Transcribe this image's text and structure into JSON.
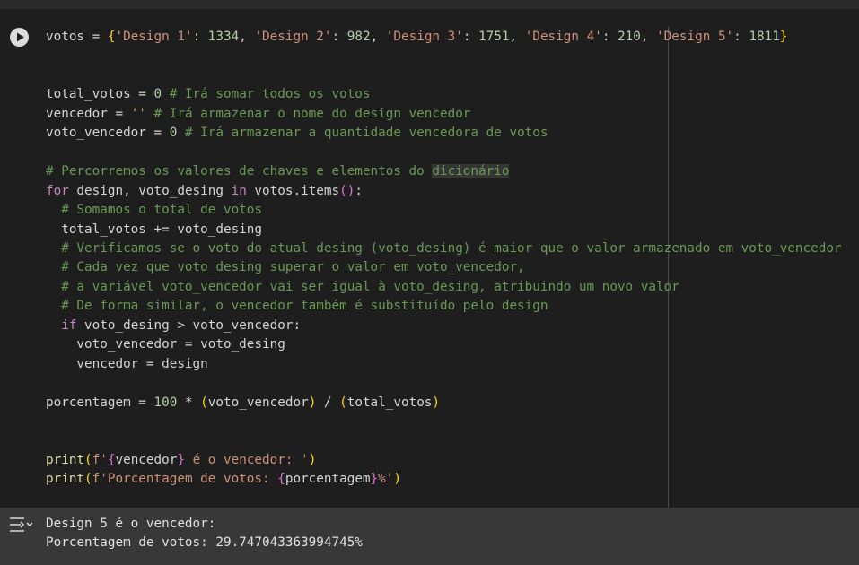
{
  "notebook": {
    "colors": {
      "background": "#1e1e1e",
      "output_background": "#383838",
      "keyword": "#c586c0",
      "string": "#ce9178",
      "number": "#b5cea8",
      "comment": "#6a9955",
      "function": "#dcdcaa"
    },
    "run_icon": "play-circle-icon",
    "output_icon": "output-toggle-icon",
    "code_lines": [
      {
        "row": 0,
        "tokens": [
          {
            "t": "votos = ",
            "c": "n"
          },
          {
            "t": "{",
            "c": "b"
          },
          {
            "t": "'Design 1'",
            "c": "s"
          },
          {
            "t": ": ",
            "c": "n"
          },
          {
            "t": "1334",
            "c": "num"
          },
          {
            "t": ", ",
            "c": "n"
          },
          {
            "t": "'Design 2'",
            "c": "s"
          },
          {
            "t": ": ",
            "c": "n"
          },
          {
            "t": "982",
            "c": "num"
          },
          {
            "t": ", ",
            "c": "n"
          },
          {
            "t": "'Design 3'",
            "c": "s"
          },
          {
            "t": ": ",
            "c": "n"
          },
          {
            "t": "1751",
            "c": "num"
          },
          {
            "t": ", ",
            "c": "n"
          },
          {
            "t": "'Design 4'",
            "c": "s"
          },
          {
            "t": ": ",
            "c": "n"
          },
          {
            "t": "210",
            "c": "num"
          },
          {
            "t": ", ",
            "c": "n"
          },
          {
            "t": "'Design 5'",
            "c": "s"
          },
          {
            "t": ": ",
            "c": "n"
          },
          {
            "t": "1811",
            "c": "num"
          },
          {
            "t": "}",
            "c": "b"
          }
        ]
      },
      {
        "row": 3,
        "tokens": [
          {
            "t": "total_votos = ",
            "c": "n"
          },
          {
            "t": "0",
            "c": "num"
          },
          {
            "t": " # Irá somar todos os votos",
            "c": "c"
          }
        ]
      },
      {
        "row": 4,
        "tokens": [
          {
            "t": "vencedor = ",
            "c": "n"
          },
          {
            "t": "''",
            "c": "s"
          },
          {
            "t": " # Irá armazenar o nome do design vencedor",
            "c": "c"
          }
        ]
      },
      {
        "row": 5,
        "tokens": [
          {
            "t": "voto_vencedor = ",
            "c": "n"
          },
          {
            "t": "0",
            "c": "num"
          },
          {
            "t": " # Irá armazenar a quantidade vencedora de votos",
            "c": "c"
          }
        ]
      },
      {
        "row": 7,
        "tokens": [
          {
            "t": "# Percorremos os valores de chaves e elementos do ",
            "c": "c"
          },
          {
            "t": "dicionário",
            "c": "c hl"
          }
        ]
      },
      {
        "row": 8,
        "tokens": [
          {
            "t": "for",
            "c": "k"
          },
          {
            "t": " design, voto_desing ",
            "c": "n"
          },
          {
            "t": "in",
            "c": "k"
          },
          {
            "t": " votos.items",
            "c": "n"
          },
          {
            "t": "()",
            "c": "b2"
          },
          {
            "t": ":",
            "c": "n"
          }
        ]
      },
      {
        "row": 9,
        "tokens": [
          {
            "t": "  # Somamos o total de votos",
            "c": "c"
          }
        ]
      },
      {
        "row": 10,
        "tokens": [
          {
            "t": "  total_votos += voto_desing",
            "c": "n"
          }
        ]
      },
      {
        "row": 11,
        "tokens": [
          {
            "t": "  # Verificamos se o voto do atual desing (voto_desing) é maior que o valor armazenado em voto_vencedor",
            "c": "c"
          }
        ]
      },
      {
        "row": 12,
        "tokens": [
          {
            "t": "  # Cada vez que voto_desing superar o valor em voto_vencedor,",
            "c": "c"
          }
        ]
      },
      {
        "row": 13,
        "tokens": [
          {
            "t": "  # a variável voto_vencedor vai ser igual à voto_desing, atribuindo um novo valor",
            "c": "c"
          }
        ]
      },
      {
        "row": 14,
        "tokens": [
          {
            "t": "  # De forma similar, o vencedor também é substituído pelo design",
            "c": "c"
          }
        ]
      },
      {
        "row": 15,
        "tokens": [
          {
            "t": "  ",
            "c": "n"
          },
          {
            "t": "if",
            "c": "k"
          },
          {
            "t": " voto_desing > voto_vencedor:",
            "c": "n"
          }
        ]
      },
      {
        "row": 16,
        "tokens": [
          {
            "t": "    voto_vencedor = voto_desing",
            "c": "n"
          }
        ]
      },
      {
        "row": 17,
        "tokens": [
          {
            "t": "    vencedor = design",
            "c": "n"
          }
        ]
      },
      {
        "row": 19,
        "tokens": [
          {
            "t": "porcentagem = ",
            "c": "n"
          },
          {
            "t": "100",
            "c": "num"
          },
          {
            "t": " * ",
            "c": "n"
          },
          {
            "t": "(",
            "c": "b"
          },
          {
            "t": "voto_vencedor",
            "c": "n"
          },
          {
            "t": ")",
            "c": "b"
          },
          {
            "t": " / ",
            "c": "n"
          },
          {
            "t": "(",
            "c": "b"
          },
          {
            "t": "total_votos",
            "c": "n"
          },
          {
            "t": ")",
            "c": "b"
          }
        ]
      },
      {
        "row": 22,
        "tokens": [
          {
            "t": "print",
            "c": "f"
          },
          {
            "t": "(",
            "c": "b"
          },
          {
            "t": "f'",
            "c": "s"
          },
          {
            "t": "{",
            "c": "b2"
          },
          {
            "t": "vencedor",
            "c": "n"
          },
          {
            "t": "}",
            "c": "b2"
          },
          {
            "t": " é o vencedor: '",
            "c": "s"
          },
          {
            "t": ")",
            "c": "b"
          }
        ]
      },
      {
        "row": 23,
        "tokens": [
          {
            "t": "print",
            "c": "f"
          },
          {
            "t": "(",
            "c": "b"
          },
          {
            "t": "f'Porcentagem de votos: ",
            "c": "s"
          },
          {
            "t": "{",
            "c": "b2"
          },
          {
            "t": "porcentagem",
            "c": "n"
          },
          {
            "t": "}",
            "c": "b2"
          },
          {
            "t": "%'",
            "c": "s"
          },
          {
            "t": ")",
            "c": "b"
          }
        ]
      }
    ],
    "output": {
      "line1": "Design 5 é o vencedor: ",
      "line2": "Porcentagem de votos: 29.747043363994745%"
    }
  }
}
